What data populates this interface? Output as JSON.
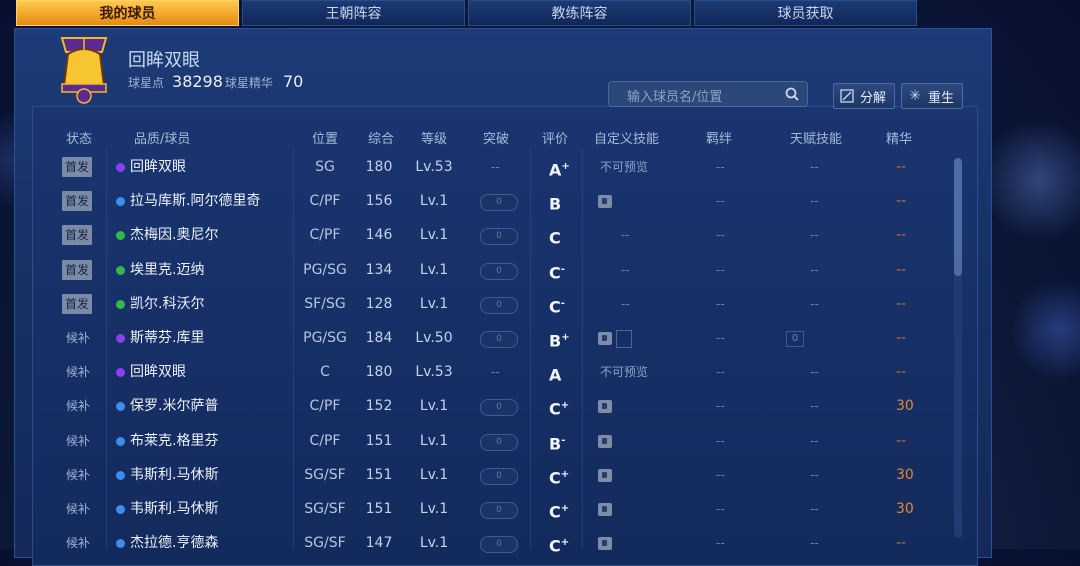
{
  "tabs": [
    {
      "label": "我的球员",
      "active": true
    },
    {
      "label": "王朝阵容",
      "active": false
    },
    {
      "label": "教练阵容",
      "active": false
    },
    {
      "label": "球员获取",
      "active": false
    }
  ],
  "profile": {
    "name": "回眸双眼",
    "star_points_label": "球星点",
    "star_points": "38298",
    "essence_label": "球星精华",
    "essence": "70"
  },
  "search": {
    "placeholder": "输入球员名/位置"
  },
  "buttons": {
    "decompose": "分解",
    "rebirth": "重生"
  },
  "columns": [
    "状态",
    "品质/球员",
    "位置",
    "综合",
    "等级",
    "突破",
    "评价",
    "自定义技能",
    "羁绊",
    "天赋技能",
    "精华"
  ],
  "colors": {
    "purple": "#8a3ff0",
    "blue": "#3a8ef0",
    "green": "#34b84a",
    "essence": "#e18a34"
  },
  "rows": [
    {
      "status": "首发",
      "quality": "purple",
      "name": "回眸双眼",
      "position": "SG",
      "overall": "180",
      "level": "Lv.53",
      "breakthrough": "--",
      "grade": "A",
      "grade_mod": "+",
      "skill": "不可预览",
      "bond": "--",
      "talent": "--",
      "essence": "--"
    },
    {
      "status": "首发",
      "quality": "blue",
      "name": "拉马库斯.阿尔德里奇",
      "position": "C/PF",
      "overall": "156",
      "level": "Lv.1",
      "breakthrough": "0",
      "grade": "B",
      "grade_mod": "",
      "skill": "lock",
      "bond": "--",
      "talent": "--",
      "essence": "--"
    },
    {
      "status": "首发",
      "quality": "green",
      "name": "杰梅因.奥尼尔",
      "position": "C/PF",
      "overall": "146",
      "level": "Lv.1",
      "breakthrough": "0",
      "grade": "C",
      "grade_mod": "",
      "skill": "--",
      "bond": "--",
      "talent": "--",
      "essence": "--"
    },
    {
      "status": "首发",
      "quality": "green",
      "name": "埃里克.迈纳",
      "position": "PG/SG",
      "overall": "134",
      "level": "Lv.1",
      "breakthrough": "0",
      "grade": "C",
      "grade_mod": "-",
      "skill": "--",
      "bond": "--",
      "talent": "--",
      "essence": "--"
    },
    {
      "status": "首发",
      "quality": "green",
      "name": "凯尔.科沃尔",
      "position": "SF/SG",
      "overall": "128",
      "level": "Lv.1",
      "breakthrough": "0",
      "grade": "C",
      "grade_mod": "-",
      "skill": "--",
      "bond": "--",
      "talent": "--",
      "essence": "--"
    },
    {
      "status": "候补",
      "quality": "purple",
      "name": "斯蒂芬.库里",
      "position": "PG/SG",
      "overall": "184",
      "level": "Lv.50",
      "breakthrough": "0",
      "grade": "B",
      "grade_mod": "+",
      "skill": "lockbox",
      "bond": "--",
      "talent": "0",
      "essence": "--"
    },
    {
      "status": "候补",
      "quality": "purple",
      "name": "回眸双眼",
      "position": "C",
      "overall": "180",
      "level": "Lv.53",
      "breakthrough": "--",
      "grade": "A",
      "grade_mod": "",
      "skill": "不可预览",
      "bond": "--",
      "talent": "--",
      "essence": "--"
    },
    {
      "status": "候补",
      "quality": "blue",
      "name": "保罗.米尔萨普",
      "position": "C/PF",
      "overall": "152",
      "level": "Lv.1",
      "breakthrough": "0",
      "grade": "C",
      "grade_mod": "+",
      "skill": "lock",
      "bond": "--",
      "talent": "--",
      "essence": "30"
    },
    {
      "status": "候补",
      "quality": "blue",
      "name": "布莱克.格里芬",
      "position": "C/PF",
      "overall": "151",
      "level": "Lv.1",
      "breakthrough": "0",
      "grade": "B",
      "grade_mod": "-",
      "skill": "lock",
      "bond": "--",
      "talent": "--",
      "essence": "--"
    },
    {
      "status": "候补",
      "quality": "blue",
      "name": "韦斯利.马休斯",
      "position": "SG/SF",
      "overall": "151",
      "level": "Lv.1",
      "breakthrough": "0",
      "grade": "C",
      "grade_mod": "+",
      "skill": "lock",
      "bond": "--",
      "talent": "--",
      "essence": "30"
    },
    {
      "status": "候补",
      "quality": "blue",
      "name": "韦斯利.马休斯",
      "position": "SG/SF",
      "overall": "151",
      "level": "Lv.1",
      "breakthrough": "0",
      "grade": "C",
      "grade_mod": "+",
      "skill": "lock",
      "bond": "--",
      "talent": "--",
      "essence": "30"
    },
    {
      "status": "候补",
      "quality": "blue",
      "name": "杰拉德.亨德森",
      "position": "SG/SF",
      "overall": "147",
      "level": "Lv.1",
      "breakthrough": "0",
      "grade": "C",
      "grade_mod": "+",
      "skill": "lock",
      "bond": "--",
      "talent": "--",
      "essence": "--"
    }
  ]
}
